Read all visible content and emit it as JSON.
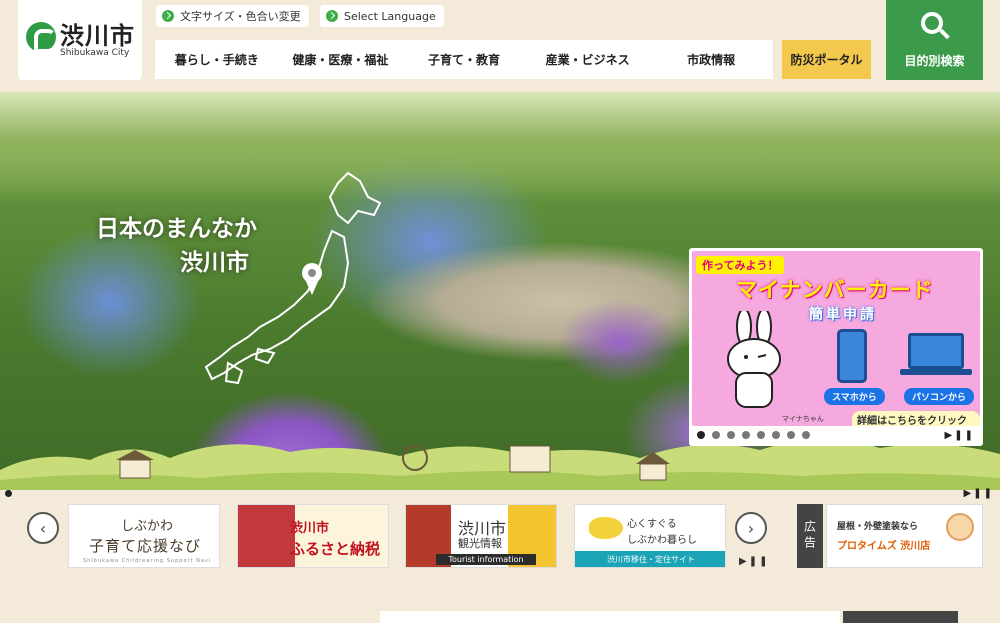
{
  "header": {
    "logo_ja": "渋川市",
    "logo_en": "Shibukawa City",
    "util_font": "文字サイズ・色合い変更",
    "util_language": "Select Language",
    "nav": [
      "暮らし・手続き",
      "健康・医療・福祉",
      "子育て・教育",
      "産業・ビジネス",
      "市政情報"
    ],
    "disaster_portal": "防災ポータル",
    "search_label": "目的別検索"
  },
  "hero": {
    "tagline_1": "日本のまんなか",
    "tagline_2": "渋川市"
  },
  "slide": {
    "tag": "作ってみよう！",
    "title": "マイナンバーカード",
    "subtitle": "簡単申請",
    "phone_label": "スマホから",
    "pc_label": "パソコンから",
    "character": "マイナちゃん",
    "detail": "詳細はこちらをクリック⇒",
    "dot_count": 8,
    "control": "▶❚❚"
  },
  "strip": {
    "control": "▶❚❚",
    "prev": "‹",
    "next": "›",
    "banner1": {
      "t1": "しぶかわ",
      "t2": "子育て応援なび",
      "t3": "Shibukawa Childrearing Support Navi"
    },
    "banner2": {
      "t1": "渋川市",
      "t2": "ふるさと納税"
    },
    "banner3": {
      "t1": "渋川市",
      "t2": "観光情報",
      "t3": "Tourist information"
    },
    "banner4": {
      "t1": "心くすぐる",
      "t2": "しぶかわ暮らし",
      "t3": "渋川市移住・定住サイト"
    },
    "pause": "▶❚❚",
    "ad_label": "広告",
    "ad": {
      "t1": "屋根・外壁塗装なら",
      "t2": "プロタイムズ 渋川店"
    }
  },
  "colors": {
    "green": "#3c9a4b",
    "yellow": "#f2c94c",
    "beige": "#f3ead9",
    "banner_pink": "#f6a9df"
  }
}
